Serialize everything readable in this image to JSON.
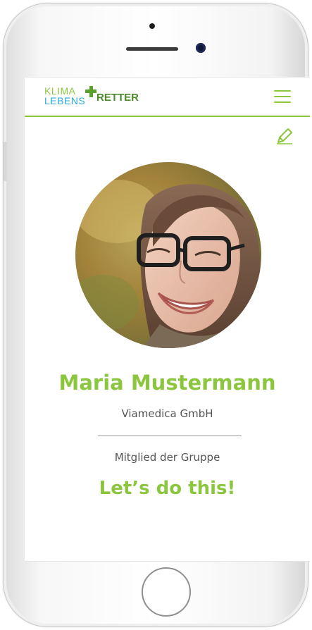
{
  "header": {
    "logo": {
      "line1": "KLIMA",
      "line2": "LEBENS",
      "word": "RETTER"
    },
    "menu_icon": "hamburger-icon"
  },
  "profile": {
    "edit_icon": "pencil-icon",
    "name": "Maria Mustermann",
    "company": "Viamedica GmbH",
    "membership": "Mitglied der Gruppe",
    "group_name": "Let’s do this!"
  },
  "colors": {
    "accent_green": "#8cc63f",
    "logo_blue": "#2aa9d6",
    "logo_dark_green": "#4a8a2a",
    "text_gray": "#555555"
  }
}
